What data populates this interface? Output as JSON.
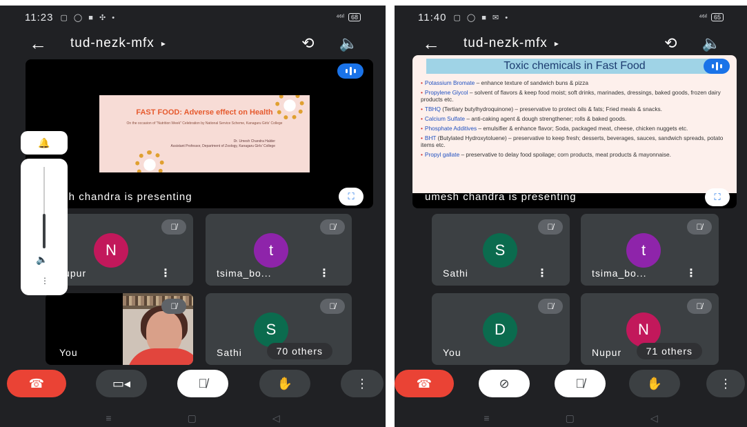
{
  "left": {
    "status": {
      "time": "11:23",
      "icons": "▢ ◯ ■ ✣ •",
      "signal": "⁴⁶ᶦˡ",
      "battery": "68"
    },
    "meeting_code": "tud-nezk-mfx",
    "slide": {
      "title": "FAST FOOD: Adverse effect on Health",
      "subtitle": "On the occasion of \"Nutrition Week\" Celebration by National Service Scheme, Kanagaru Girls' College",
      "author": "Dr. Umesh Chandra Halder",
      "author_role": "Assistant Professor, Department of Zoology, Kanagaru Girls' College"
    },
    "presenting_label": "umesh chandra is presenting",
    "tiles": [
      {
        "name": "Nupur",
        "initial": "N",
        "color": "#c2185b"
      },
      {
        "name": "tsima_bo...",
        "initial": "t",
        "color": "#8e24aa"
      },
      {
        "name": "You",
        "initial": ""
      },
      {
        "name": "Sathi",
        "initial": "S",
        "color": "#0b6b4e",
        "others": "70 others"
      }
    ],
    "volume_level": 0.42
  },
  "right": {
    "status": {
      "time": "11:40",
      "icons": "▢ ◯ ■ ✉ •",
      "signal": "⁴⁶ᶦˡ",
      "battery": "65"
    },
    "meeting_code": "tud-nezk-mfx",
    "slide": {
      "title": "Toxic chemicals in Fast Food",
      "bullets": [
        {
          "term": "Potassium Bromate",
          "desc": " – enhance texture of sandwich buns & pizza"
        },
        {
          "term": "Propylene Glycol",
          "desc": " – solvent of flavors & keep food moist; soft drinks, marinades, dressings, baked goods, frozen dairy products etc."
        },
        {
          "term": "TBHQ",
          "desc": " (Tertiary butylhydroquinone) – preservative to protect oils & fats; Fried meals & snacks."
        },
        {
          "term": "Calcium Sulfate",
          "desc": " – anti-caking agent & dough strengthener; rolls & baked goods."
        },
        {
          "term": "Phosphate Additives",
          "desc": " – emulsifier & enhance flavor; Soda, packaged meat, cheese, chicken nuggets etc."
        },
        {
          "term": "BHT",
          "desc": " (Butylated Hydroxytoluene) – preservative to keep fresh; desserts, beverages, sauces, sandwich spreads, potato items etc."
        },
        {
          "term": "Propyl gallate",
          "desc": " – preservative to delay food spoilage; corn products, meat products & mayonnaise."
        }
      ]
    },
    "presenting_label": "umesh chandra is presenting",
    "tiles": [
      {
        "name": "Sathi",
        "initial": "S",
        "color": "#0b6b4e"
      },
      {
        "name": "tsima_bo...",
        "initial": "t",
        "color": "#8e24aa"
      },
      {
        "name": "You",
        "initial": "D",
        "color": "#0b6b4e"
      },
      {
        "name": "Nupur",
        "initial": "N",
        "color": "#c2185b",
        "others": "71 others"
      }
    ]
  },
  "icons": {
    "back": "←",
    "play": "▸",
    "switch_camera": "⟲",
    "speaker": "🔈",
    "mic_off": "🎙̸",
    "more_vert": "⋮",
    "camera": "▭◂",
    "camera_off": "⊘",
    "hand": "✋",
    "end_call": "☎",
    "fullscreen": "⛶",
    "nav_menu": "≡",
    "nav_home": "▢",
    "nav_back": "◁",
    "bell": "🔔",
    "more_horiz": "⋮"
  }
}
